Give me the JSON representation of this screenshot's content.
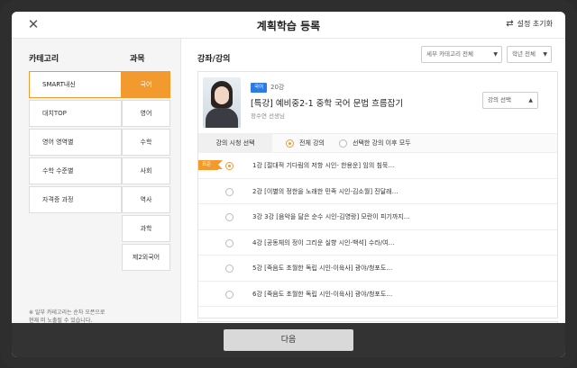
{
  "header": {
    "title": "계획학습 등록",
    "reset_label": "설정 초기화"
  },
  "left": {
    "category_heading": "카테고리",
    "subject_heading": "과목",
    "categories": [
      {
        "label": "SMART내신"
      },
      {
        "label": "대치TOP"
      },
      {
        "label": "영어 영역별"
      },
      {
        "label": "수학 수준별"
      },
      {
        "label": "자격증 과정"
      }
    ],
    "subjects": [
      {
        "label": "국어"
      },
      {
        "label": "영어"
      },
      {
        "label": "수학"
      },
      {
        "label": "사회"
      },
      {
        "label": "역사"
      },
      {
        "label": "과학"
      },
      {
        "label": "제2외국어"
      }
    ],
    "note_line1": "※ 일부 카테고리는 순차 오픈으로",
    "note_line2": "현재 미 노출될 수 있습니다."
  },
  "right": {
    "title": "강좌/강의",
    "filter_category": "세부 카테고리 전체",
    "filter_grade": "학년 전체"
  },
  "course": {
    "badge": "국어",
    "lecture_count": "20강",
    "title": "[특강] 예비중2-1 중학 국어 문법 흐름잡기",
    "teacher": "정수연 선생님",
    "lecture_select": "강의 선택",
    "start_label": "강의 시청 선택",
    "option_all": "전체 강의",
    "option_after": "선택한 강의 이후 모두"
  },
  "lectures": [
    {
      "text": "1강 [절대적 기다림의 저항 시인- 한용운] 임의 침묵…",
      "flag": "표준"
    },
    {
      "text": "2강 [이별의 정한을 노래한 민족 시인-김소월] 진달래…"
    },
    {
      "text": "3강 3강 [음악을 닮은 순수 시인-김영랑] 모란이 피기까지…"
    },
    {
      "text": "4강 [공동체의 정이 그리운 실향 시인-백석] 수라/여…"
    },
    {
      "text": "5강 [죽음도 초월한 독립 시인-이육사] 광야/청포도…"
    },
    {
      "text": "6강 [죽음도 초월한 독립 시인-이육사] 광야/청포도…"
    }
  ],
  "footer": {
    "next_label": "다음"
  },
  "colors": {
    "accent": "#f29a2e",
    "badge_blue": "#2f7be5",
    "footer_bg": "#333333"
  },
  "icons": {
    "close": "close-icon",
    "reset": "refresh-icon",
    "dropdown": "chevron-down-icon"
  }
}
